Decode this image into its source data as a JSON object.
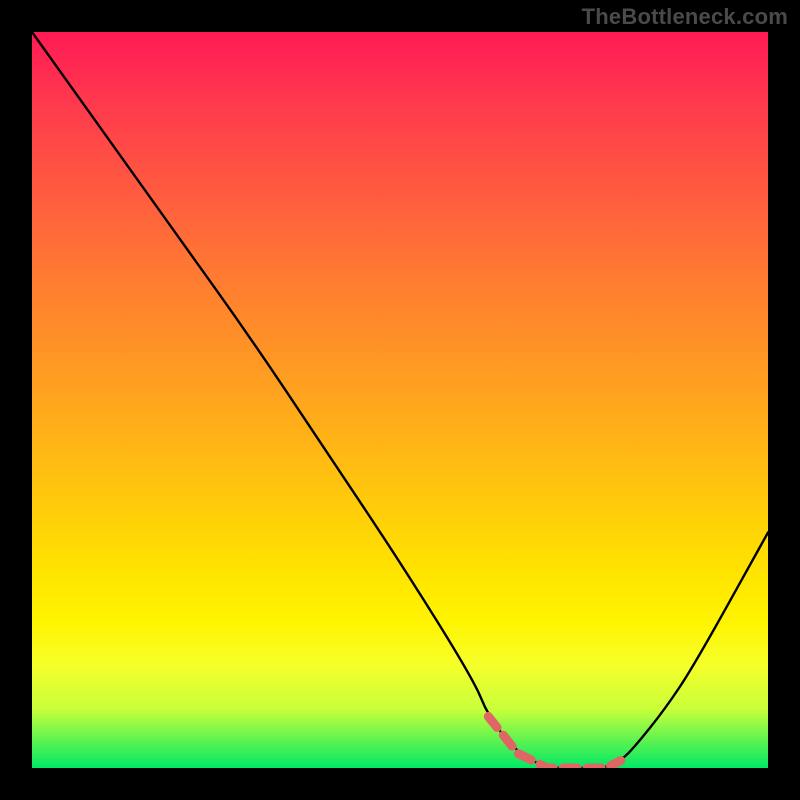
{
  "watermark": "TheBottleneck.com",
  "chart_data": {
    "type": "line",
    "title": "",
    "xlabel": "",
    "ylabel": "",
    "xlim": [
      0,
      100
    ],
    "ylim": [
      0,
      100
    ],
    "series": [
      {
        "name": "bottleneck-curve",
        "x": [
          0,
          10,
          20,
          30,
          40,
          50,
          60,
          62,
          66,
          70,
          74,
          78,
          80,
          82,
          86,
          90,
          100
        ],
        "y": [
          100,
          86,
          72,
          58,
          43,
          28,
          12,
          7,
          2,
          0,
          0,
          0,
          1,
          3,
          8,
          14,
          32
        ]
      },
      {
        "name": "optimal-band",
        "x": [
          62,
          66,
          70,
          74,
          78,
          80
        ],
        "y": [
          7,
          2,
          0,
          0,
          0,
          1
        ]
      }
    ],
    "gradient_stops": [
      {
        "pos": 0,
        "color": "#ff1a55"
      },
      {
        "pos": 22,
        "color": "#ff5c3f"
      },
      {
        "pos": 48,
        "color": "#ffa020"
      },
      {
        "pos": 72,
        "color": "#ffe000"
      },
      {
        "pos": 100,
        "color": "#00e865"
      }
    ]
  }
}
